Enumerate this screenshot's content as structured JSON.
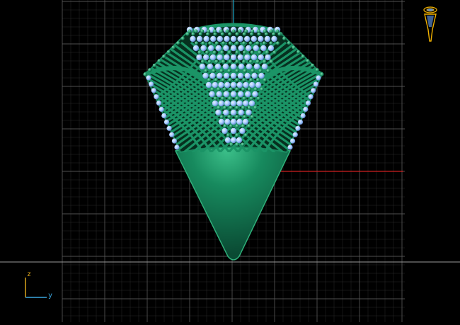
{
  "viewport": {
    "view": "front",
    "background": "#000000",
    "grid_color": "#5a5a5a",
    "axis_colors": {
      "x": "#d02020",
      "z": "#1aa6c6"
    },
    "object": {
      "name": "lattice-cone-jewel",
      "body_color": "#0f6e4f",
      "lattice_color": "#1a8a60",
      "bead_color": "#9ec6ff"
    }
  },
  "triad": {
    "axis_up_label": "z",
    "axis_right_label": "y",
    "up_color": "#d9a21b",
    "right_color": "#3aa7e0"
  },
  "orientation_widget": {
    "icon": "view-cube-icon",
    "color": "#f2b200"
  }
}
